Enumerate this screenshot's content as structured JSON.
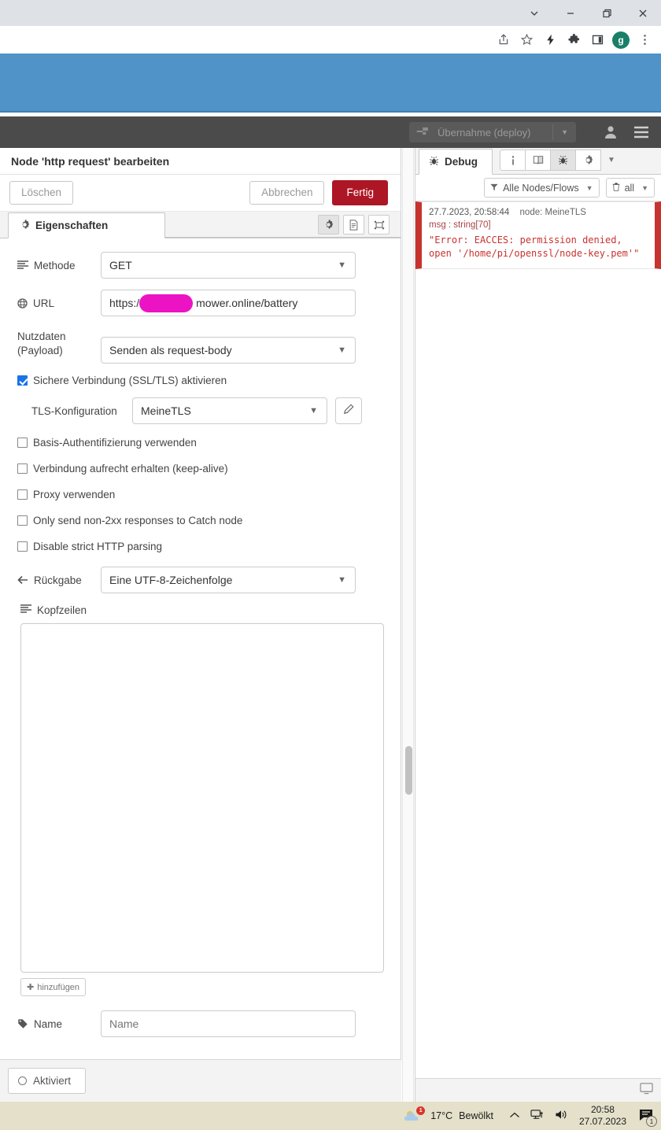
{
  "browser": {
    "window_controls": [
      "chevron-down",
      "minimize",
      "restore",
      "close"
    ],
    "toolbar_icons": [
      "share-icon",
      "star-icon",
      "lightning-icon",
      "extensions-icon",
      "sidepanel-icon"
    ],
    "profile_initial": "g"
  },
  "nodered_header": {
    "deploy_label": "Übernahme (deploy)",
    "user_icon": "user-icon",
    "menu_icon": "hamburger-menu-icon"
  },
  "editor": {
    "title": "Node 'http request' bearbeiten",
    "delete_label": "Löschen",
    "cancel_label": "Abbrechen",
    "done_label": "Fertig",
    "tab_label": "Eigenschaften",
    "tab_icon_buttons": [
      "gear-icon",
      "description-icon",
      "appearance-icon"
    ],
    "enable_label": "Aktiviert",
    "fields": {
      "method_label": "Methode",
      "method_value": "GET",
      "url_label": "URL",
      "url_value_prefix": "https:/",
      "url_value_suffix": "mower.online/battery",
      "payload_label_line1": "Nutzdaten",
      "payload_label_line2": "(Payload)",
      "payload_value": "Senden als request-body",
      "ssl_label": "Sichere Verbindung (SSL/TLS) aktivieren",
      "ssl_checked": true,
      "tls_config_label": "TLS-Konfiguration",
      "tls_config_value": "MeineTLS",
      "basic_auth_label": "Basis-Authentifizierung verwenden",
      "keepalive_label": "Verbindung aufrecht erhalten (keep-alive)",
      "proxy_label": "Proxy verwenden",
      "non2xx_label": "Only send non-2xx responses to Catch node",
      "strict_parsing_label": "Disable strict HTTP parsing",
      "return_label": "Rückgabe",
      "return_value": "Eine UTF-8-Zeichenfolge",
      "headers_label": "Kopfzeilen",
      "add_label": "hinzufügen",
      "name_label": "Name",
      "name_placeholder": "Name"
    }
  },
  "sidebar": {
    "tab_label": "Debug",
    "tab_icon": "bug-icon",
    "header_buttons": [
      "info-icon",
      "help-book-icon",
      "bug-icon",
      "gear-icon"
    ],
    "filter_label": "Alle Nodes/Flows",
    "clear_label": "all",
    "messages": [
      {
        "timestamp": "27.7.2023, 20:58:44",
        "node": "node: MeineTLS",
        "type": "msg : string[70]",
        "body": "\"Error: EACCES: permission denied, open '/home/pi/openssl/node-key.pem'\""
      }
    ]
  },
  "taskbar": {
    "temperature": "17°C",
    "condition": "Bewölkt",
    "weather_badge": "1",
    "tray_icons": [
      "chevron-up-icon",
      "network-icon",
      "volume-icon"
    ],
    "time": "20:58",
    "date": "27.07.2023",
    "notification_count": "1"
  },
  "colors": {
    "accent_red": "#ad1625",
    "debug_red": "#c7332f",
    "blue_band": "#4f93c9",
    "header_dark": "#4b4b4b",
    "redaction_pink": "#ec13c4",
    "checkbox_blue": "#1a73e8",
    "taskbar": "#e4e0ca"
  }
}
